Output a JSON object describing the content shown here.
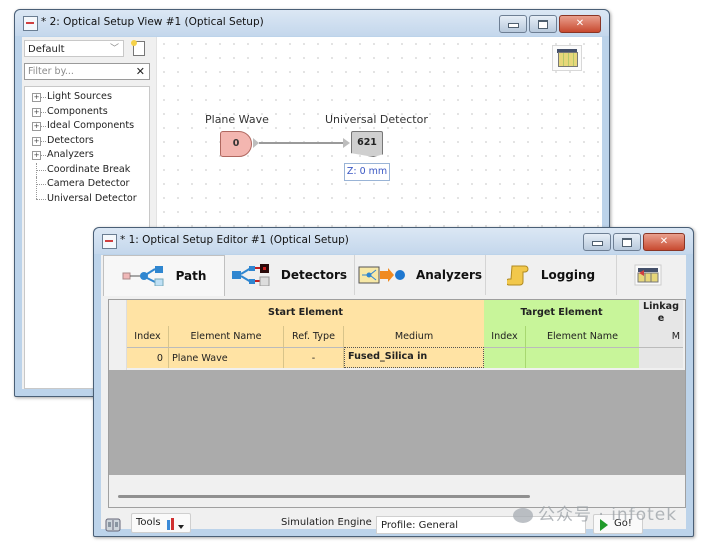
{
  "view_window": {
    "title": "* 2: Optical Setup View #1 (Optical Setup)",
    "controls": {
      "minimize": "minimize",
      "maximize": "maximize",
      "close": "close"
    },
    "sidebar": {
      "preset_select": {
        "value": "Default"
      },
      "filter": {
        "placeholder": "Filter by...",
        "value": ""
      },
      "tree": [
        {
          "label": "Light Sources",
          "expandable": true
        },
        {
          "label": "Components",
          "expandable": true
        },
        {
          "label": "Ideal Components",
          "expandable": true
        },
        {
          "label": "Detectors",
          "expandable": true
        },
        {
          "label": "Analyzers",
          "expandable": true
        },
        {
          "label": "Coordinate Break",
          "expandable": false
        },
        {
          "label": "Camera Detector",
          "expandable": false
        },
        {
          "label": "Universal Detector",
          "expandable": false
        }
      ]
    },
    "canvas": {
      "source_node": {
        "label": "Plane Wave",
        "index": "0",
        "color": "#f3b6b0"
      },
      "detector_node": {
        "label": "Universal Detector",
        "index": "621",
        "color": "#cfcfcf"
      },
      "position_badge": "Z: 0 mm"
    }
  },
  "editor_window": {
    "title": "* 1: Optical Setup Editor #1 (Optical Setup)",
    "tabs": [
      {
        "label": "Path",
        "active": true
      },
      {
        "label": "Detectors",
        "active": false
      },
      {
        "label": "Analyzers",
        "active": false
      },
      {
        "label": "Logging",
        "active": false
      }
    ],
    "table": {
      "group_headers": {
        "start": "Start Element",
        "target": "Target Element",
        "linkage": "Linkag e"
      },
      "columns": [
        "Index",
        "Element Name",
        "Ref. Type",
        "Medium",
        "Index",
        "Element Name",
        "M"
      ],
      "rows": [
        {
          "start_index": "0",
          "start_name": "Plane Wave",
          "ref_type": "-",
          "medium": "Fused_Silica in",
          "target_index": "",
          "target_name": "",
          "linkage": ""
        }
      ]
    },
    "bottom": {
      "tools_label": "Tools",
      "engine_label": "Simulation Engine",
      "engine_value": "Profile: General",
      "go_label": "Go!"
    }
  },
  "watermark": "公众号 · infotek",
  "colors": {
    "start_header": "#ffe3a4",
    "target_header": "#c8f59a",
    "close_button": "#c84a30",
    "position_text": "#3b58c4"
  }
}
